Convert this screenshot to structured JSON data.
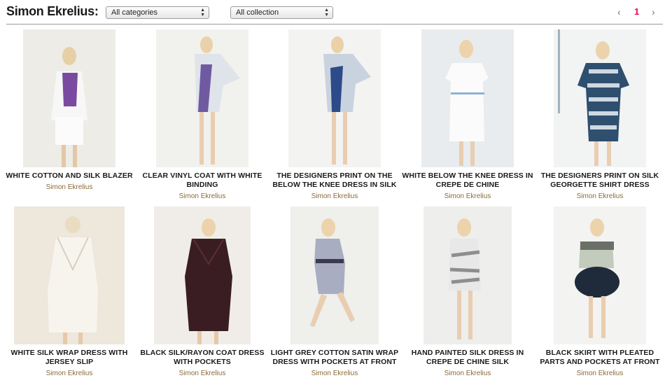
{
  "header": {
    "brand": "Simon Ekrelius:",
    "category_select": "All categories",
    "collection_select": "All collection",
    "pager": {
      "prev_icon": "‹",
      "current_page": "1",
      "next_icon": "›"
    }
  },
  "colors": {
    "accent": "#e2065a",
    "brand_text": "#8a6a3a",
    "rule": "#9a9a9a"
  },
  "products": [
    {
      "title": "WHITE COTTON AND SILK BLAZER",
      "designer": "Simon Ekrelius"
    },
    {
      "title": "CLEAR VINYL COAT WITH WHITE BINDING",
      "designer": "Simon Ekrelius"
    },
    {
      "title": "THE DESIGNERS PRINT ON THE BELOW THE KNEE DRESS IN SILK",
      "designer": "Simon Ekrelius"
    },
    {
      "title": "WHITE BELOW THE KNEE DRESS IN CREPE DE CHINE",
      "designer": "Simon Ekrelius"
    },
    {
      "title": "THE DESIGNERS PRINT ON SILK GEORGETTE SHIRT DRESS",
      "designer": "Simon Ekrelius"
    },
    {
      "title": "WHITE SILK WRAP DRESS WITH JERSEY SLIP",
      "designer": "Simon Ekrelius"
    },
    {
      "title": "BLACK SILK/RAYON COAT DRESS WITH POCKETS",
      "designer": "Simon Ekrelius"
    },
    {
      "title": "LIGHT GREY COTTON SATIN WRAP DRESS WITH POCKETS AT FRONT",
      "designer": "Simon Ekrelius"
    },
    {
      "title": "HAND PAINTED SILK DRESS IN CREPE DE CHINE SILK",
      "designer": "Simon Ekrelius"
    },
    {
      "title": "BLACK SKIRT WITH PLEATED PARTS AND POCKETS AT FRONT",
      "designer": "Simon Ekrelius"
    }
  ]
}
